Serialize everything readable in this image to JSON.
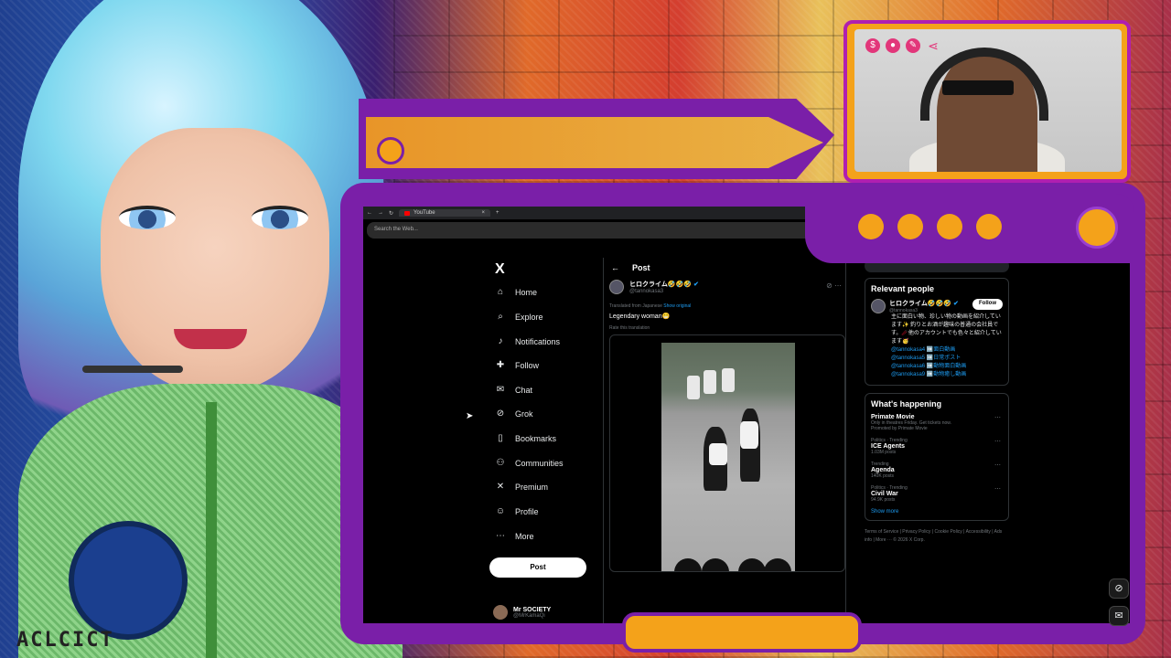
{
  "art": {
    "caption": "ACLCICT"
  },
  "webcam": {
    "icons": [
      "dollar-icon",
      "user-icon",
      "paperclip-icon",
      "share-icon"
    ],
    "icon_glyphs": [
      "$",
      "●",
      "✎",
      "⋖"
    ]
  },
  "browser": {
    "tab_title": "YouTube",
    "tab_close": "×",
    "new_tab": "+",
    "url_placeholder": "Search the Web..."
  },
  "x": {
    "logo": "X",
    "nav": [
      {
        "label": "Home",
        "icon": "home-icon",
        "glyph": "⌂"
      },
      {
        "label": "Explore",
        "icon": "search-icon",
        "glyph": "⌕"
      },
      {
        "label": "Notifications",
        "icon": "bell-icon",
        "glyph": "♪"
      },
      {
        "label": "Follow",
        "icon": "add-user-icon",
        "glyph": "✚"
      },
      {
        "label": "Chat",
        "icon": "mail-icon",
        "glyph": "✉"
      },
      {
        "label": "Grok",
        "icon": "grok-icon",
        "glyph": "⊘"
      },
      {
        "label": "Bookmarks",
        "icon": "bookmark-icon",
        "glyph": "▯"
      },
      {
        "label": "Communities",
        "icon": "communities-icon",
        "glyph": "⚇"
      },
      {
        "label": "Premium",
        "icon": "x-icon",
        "glyph": "✕"
      },
      {
        "label": "Profile",
        "icon": "profile-icon",
        "glyph": "☺"
      },
      {
        "label": "More",
        "icon": "more-icon",
        "glyph": "⋯"
      }
    ],
    "post_button": "Post",
    "account": {
      "name": "Mr SOCIETY",
      "handle": "@MrKamaQi"
    },
    "post_header": {
      "back": "←",
      "title": "Post"
    },
    "tweet": {
      "author": "ヒロクライム🤣🤣🤣",
      "handle": "@tannokasa3",
      "translated_prefix": "Translated from Japanese",
      "show_original": "Show original",
      "text": "Legendary woman😁",
      "rate": "Rate this translation"
    },
    "relevant": {
      "title": "Relevant people",
      "name": "ヒロクライム🤣🤣🤣",
      "handle": "@tannokasa3",
      "follow": "Follow",
      "bio": "主に面白い物、珍しい物の動画を紹介しています✨ 釣りとお酒が趣味の普通の会社員です。🥢他のアカウントでも色々と紹介しています🥳",
      "links": [
        "@tannokasa4 ➡️面白動画",
        "@tannokasa5 ➡️日常ポスト",
        "@tannokasa6 ➡️動物面白動画",
        "@tannokasa9 ➡️動物癒し動画"
      ]
    },
    "happening": {
      "title": "What's happening",
      "trends": [
        {
          "meta": "",
          "name": "Primate Movie",
          "sub": "Only in theatres Friday. Get tickets now.",
          "sub2": "Promoted by Primate Movie"
        },
        {
          "meta": "Politics · Trending",
          "name": "ICE Agents",
          "sub": "1.03M posts",
          "sub2": ""
        },
        {
          "meta": "Trending",
          "name": "Agenda",
          "sub": "140K posts",
          "sub2": ""
        },
        {
          "meta": "Politics · Trending",
          "name": "Civil War",
          "sub": "94.9K posts",
          "sub2": ""
        }
      ],
      "show_more": "Show more"
    },
    "footer": "Terms of Service | Privacy Policy | Cookie Policy | Accessibility | Ads info | More ··· © 2026 X Corp."
  },
  "colors": {
    "frame_purple": "#7a1fa8",
    "accent_orange": "#f4a21a",
    "x_blue": "#1d9bf0"
  }
}
